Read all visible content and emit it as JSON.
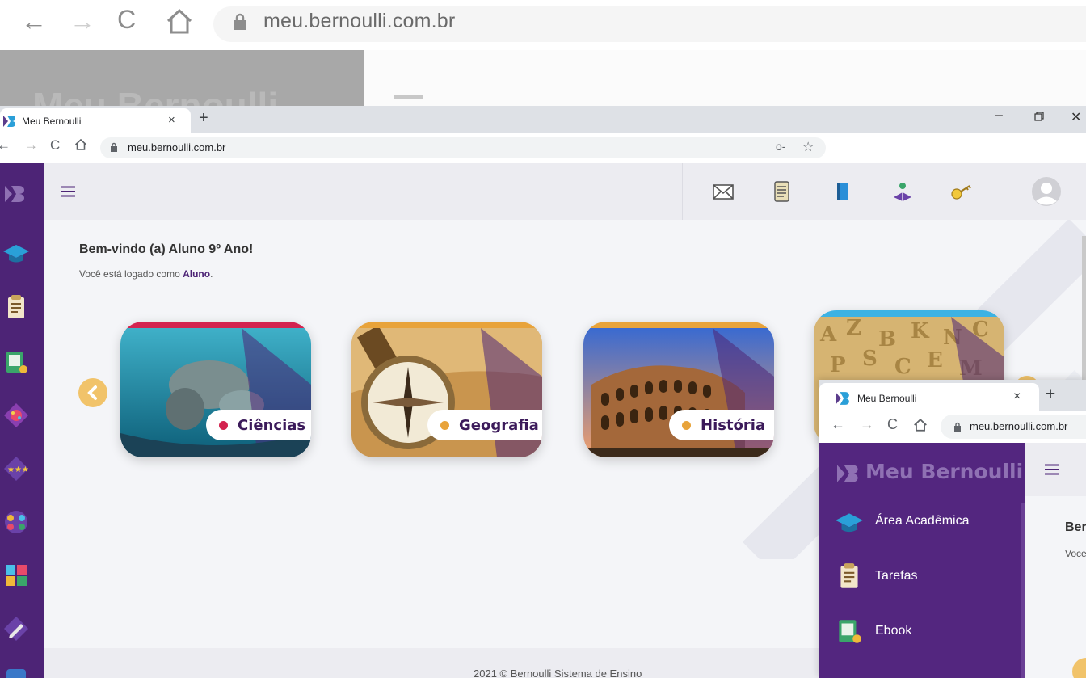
{
  "background_browser": {
    "url": "meu.bernoulli.com.br",
    "logo": "Meu Bernoulli"
  },
  "main_browser": {
    "tab": {
      "title": "Meu Bernoulli",
      "close": "×"
    },
    "new_tab": "+",
    "window_controls": {
      "minimize": "–",
      "close": "✕"
    },
    "nav": {
      "back": "←",
      "forward": "→",
      "reload": "C",
      "home": "⌂"
    },
    "url": "meu.bernoulli.com.br",
    "key_icon": "o-",
    "star_icon": "☆"
  },
  "page": {
    "welcome": "Bem-vindo (a) Aluno 9º Ano!",
    "logged_prefix": "Você está logado como ",
    "role": "Aluno",
    "logged_suffix": ".",
    "header_icons": [
      "mail-icon",
      "document-icon",
      "notebook-icon",
      "book-reader-icon",
      "key-icon"
    ],
    "sidebar_icons": [
      "logo-icon",
      "academic-cap-icon",
      "tasks-icon",
      "ebook-icon",
      "puzzle-icon",
      "stars-icon",
      "group-icon",
      "teamwork-icon",
      "pencil-icon",
      "book-icon"
    ],
    "subjects": [
      {
        "name": "Ciências",
        "color": "#d3234f"
      },
      {
        "name": "Geografia",
        "color": "#e8a33a"
      },
      {
        "name": "História",
        "color": "#e8a33a"
      },
      {
        "name": "",
        "color": "#3db2e3"
      }
    ],
    "footer": "2021 © Bernoulli Sistema de Ensino"
  },
  "front_window": {
    "tab_title": "Meu Bernoulli",
    "close": "×",
    "new_tab": "+",
    "url": "meu.bernoulli.com.br",
    "logo": "Meu Bernoulli",
    "menu": [
      {
        "label": "Área Acadêmica"
      },
      {
        "label": "Tarefas"
      },
      {
        "label": "Ebook"
      }
    ],
    "welcome_partial": "Ber",
    "logged_partial": "Voce"
  },
  "colors": {
    "brand_purple": "#4d2476",
    "accent_yellow": "#f1c36a"
  }
}
